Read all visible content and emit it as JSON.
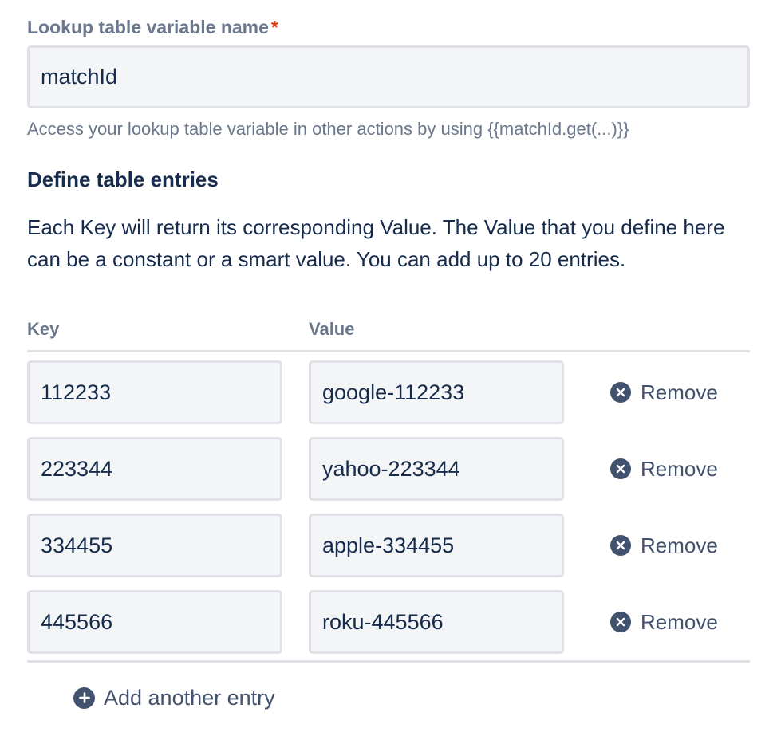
{
  "lookup_field": {
    "label": "Lookup table variable name",
    "required_marker": "*",
    "value": "matchId",
    "helper": "Access your lookup table variable in other actions by using {{matchId.get(...)}}"
  },
  "entries_section": {
    "title": "Define table entries",
    "description": "Each Key will return its corresponding Value. The Value that you define here can be a constant or a smart value. You can add up to 20 entries.",
    "key_header": "Key",
    "value_header": "Value",
    "remove_label": "Remove",
    "rows": [
      {
        "key": "112233",
        "value": "google-112233"
      },
      {
        "key": "223344",
        "value": "yahoo-223344"
      },
      {
        "key": "334455",
        "value": "apple-334455"
      },
      {
        "key": "445566",
        "value": "roku-445566"
      }
    ],
    "add_label": "Add another entry"
  },
  "icons": {
    "remove": "close-circle-icon",
    "add": "plus-circle-icon"
  },
  "colors": {
    "text": "#172b4d",
    "muted": "#6b778c",
    "required": "#de350b",
    "icon": "#42526e",
    "input_bg": "#f4f5f7",
    "input_border": "#dfe1e6"
  }
}
